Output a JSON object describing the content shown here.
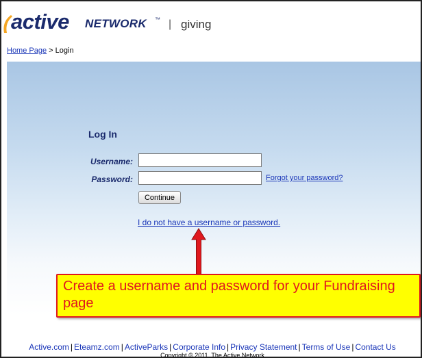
{
  "header": {
    "logo_word": "active",
    "logo_network": "NETWORK",
    "logo_tm": "™",
    "logo_separator": "|",
    "logo_giving": "giving"
  },
  "breadcrumb": {
    "home": "Home Page",
    "separator": ">",
    "current": "Login"
  },
  "login": {
    "title": "Log In",
    "username_label": "Username:",
    "password_label": "Password:",
    "username_value": "",
    "password_value": "",
    "forgot_link": "Forgot your password?",
    "continue_button": "Continue",
    "no_account_link": "I do not have a username or password."
  },
  "annotation": {
    "text": "Create a username and password for your Fundraising page"
  },
  "footer": {
    "links": [
      "Active.com",
      "Eteamz.com",
      "ActiveParks",
      "Corporate Info",
      "Privacy Statement",
      "Terms of Use",
      "Contact Us"
    ],
    "separator": "|",
    "copyright": "Copyright © 2011. The Active Network"
  },
  "colors": {
    "brand_navy": "#1a2a6c",
    "link_blue": "#1a36b8",
    "swoosh_orange": "#f5a623",
    "callout_yellow": "#ffff00",
    "callout_red": "#e0181e"
  }
}
